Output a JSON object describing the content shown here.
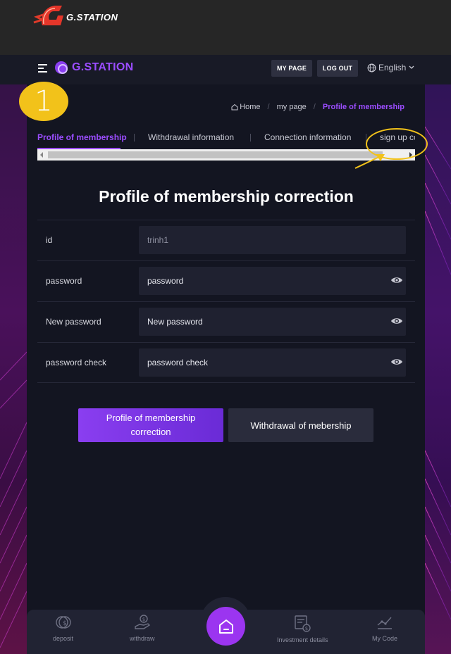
{
  "top_logo": {
    "text": "G.STATION"
  },
  "navbar": {
    "brand": "G.STATION",
    "my_page": "MY PAGE",
    "log_out": "LOG OUT",
    "language": "English"
  },
  "step_badge": "1",
  "breadcrumb": {
    "home": "Home",
    "sep": "/",
    "my_page": "my page",
    "current": "Profile of membership"
  },
  "tabs": [
    {
      "label": "Profile of membership",
      "active": true
    },
    {
      "label": "Withdrawal information"
    },
    {
      "label": "Connection information"
    },
    {
      "label": "sign up cc"
    }
  ],
  "page_title": "Profile of membership correction",
  "form": [
    {
      "label": "id",
      "value": "trinh1",
      "muted": true
    },
    {
      "label": "password",
      "placeholder": "password"
    },
    {
      "label": "New password",
      "placeholder": "New password"
    },
    {
      "label": "password check",
      "placeholder": "password check"
    }
  ],
  "buttons": {
    "primary_line1": "Profile of membership",
    "primary_line2": "correction",
    "secondary": "Withdrawal of mebership"
  },
  "bottom_nav": {
    "deposit": "deposit",
    "withdraw": "withdraw",
    "investment": "Investment details",
    "my_code": "My Code"
  },
  "colors": {
    "accent": "#9b4dff",
    "highlight": "#f2c21a"
  }
}
